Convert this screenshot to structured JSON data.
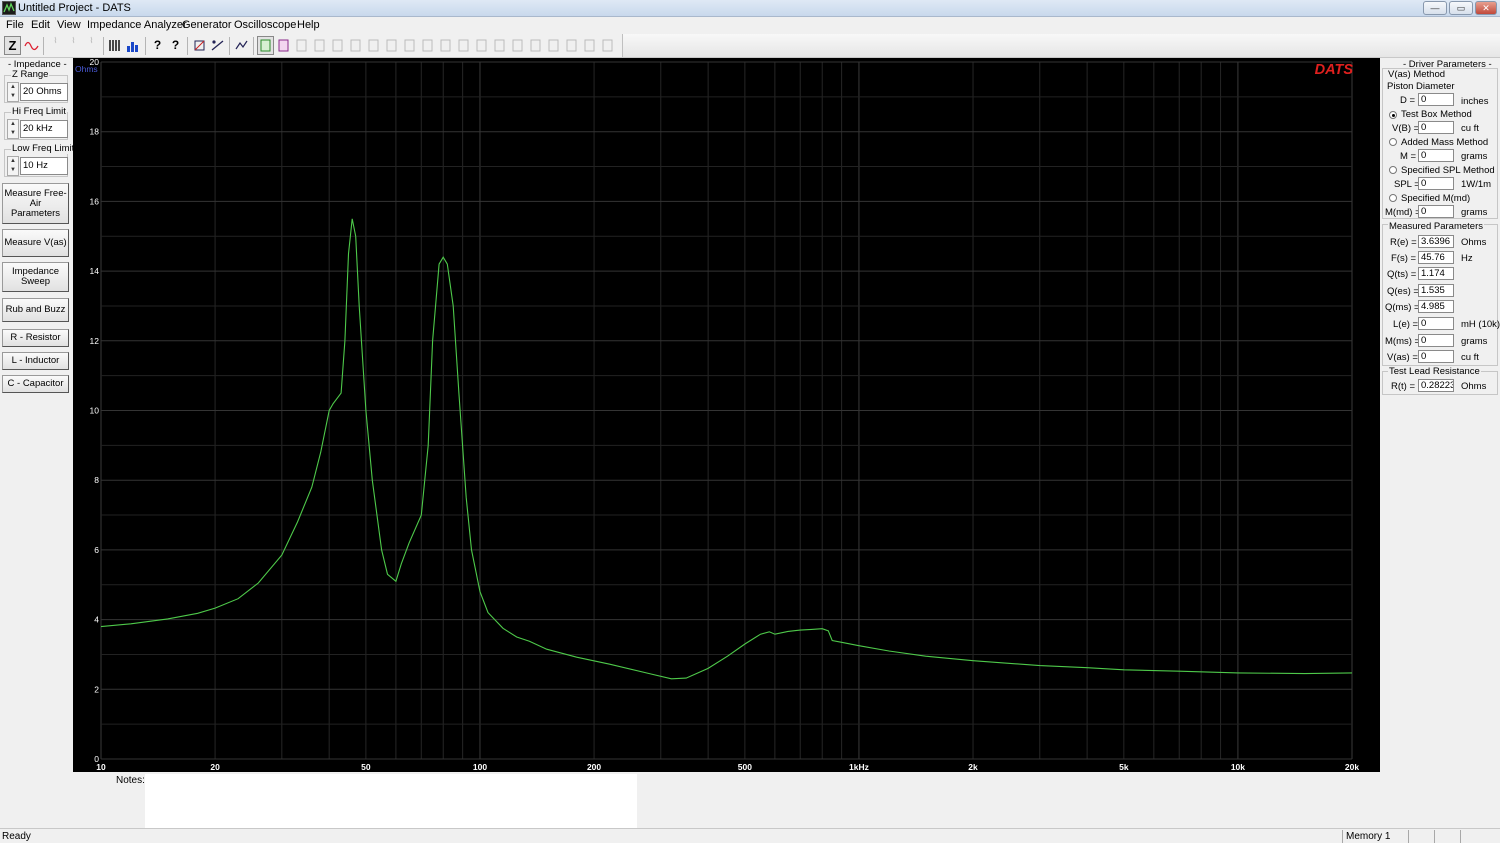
{
  "window": {
    "title": "Untitled Project - DATS",
    "controls": {
      "minimize": "—",
      "maximize": "▭",
      "close": "✕"
    }
  },
  "menu": [
    "File",
    "Edit",
    "View",
    "Impedance Analyzer",
    "Generator",
    "Oscilloscope",
    "Help"
  ],
  "toolbar": {
    "buttons": [
      {
        "name": "impedance-mode-button",
        "label": "Z",
        "icon": "z-icon"
      },
      {
        "name": "phase-mode-button",
        "label": "",
        "icon": "sine-wave-icon"
      },
      {
        "name": "tb-dim-1-button",
        "label": "⌇",
        "icon": "dim-icon"
      },
      {
        "name": "tb-dim-2-button",
        "label": "⌇",
        "icon": "dim-icon"
      },
      {
        "name": "tb-dim-3-button",
        "label": "⌇",
        "icon": "dim-icon"
      },
      {
        "name": "generator-button",
        "label": "",
        "icon": "bars-icon"
      },
      {
        "name": "analyzer-button",
        "label": "",
        "icon": "histogram-icon"
      },
      {
        "name": "help-button",
        "label": "?",
        "icon": "question-icon"
      },
      {
        "name": "context-help-button",
        "label": "?",
        "icon": "context-help-icon"
      },
      {
        "name": "tb-a-button",
        "label": "",
        "icon": "tool-icon"
      },
      {
        "name": "tb-b-button",
        "label": "",
        "icon": "tool-icon"
      },
      {
        "name": "tb-c-button",
        "label": "",
        "icon": "tool-icon"
      },
      {
        "name": "memory-1-button",
        "label": "",
        "icon": "memory-icon"
      },
      {
        "name": "memory-2-button",
        "label": "",
        "icon": "memory-icon"
      }
    ]
  },
  "left_panel": {
    "group_title": "- Impedance -",
    "z_range": {
      "label": "Z Range",
      "value": "20 Ohms"
    },
    "hi_freq": {
      "label": "Hi Freq Limit",
      "value": "20 kHz"
    },
    "low_freq": {
      "label": "Low Freq Limit",
      "value": "10 Hz"
    },
    "buttons": {
      "free_air": "Measure Free-Air Parameters",
      "measure_vas": "Measure V(as)",
      "impedance_sweep": "Impedance Sweep",
      "rub_buzz": "Rub and Buzz",
      "resistor": "R - Resistor",
      "inductor": "L - Inductor",
      "capacitor": "C - Capacitor"
    }
  },
  "chart_data": {
    "type": "line",
    "brand": "DATS",
    "y_unit": "Ohms",
    "xscale": "log",
    "xlim": [
      10,
      20000
    ],
    "ylim": [
      0,
      20
    ],
    "grid": true,
    "x_ticks": [
      {
        "value": 10,
        "label": "10"
      },
      {
        "value": 20,
        "label": "20"
      },
      {
        "value": 50,
        "label": "50"
      },
      {
        "value": 100,
        "label": "100"
      },
      {
        "value": 200,
        "label": "200"
      },
      {
        "value": 500,
        "label": "500"
      },
      {
        "value": 1000,
        "label": "1kHz"
      },
      {
        "value": 2000,
        "label": "2k"
      },
      {
        "value": 5000,
        "label": "5k"
      },
      {
        "value": 10000,
        "label": "10k"
      },
      {
        "value": 20000,
        "label": "20k"
      }
    ],
    "y_ticks": [
      0,
      2,
      4,
      6,
      8,
      10,
      12,
      14,
      16,
      18,
      20
    ],
    "colors": {
      "background": "#000000",
      "grid": "#2d2d2d",
      "curve": "#4ec94a",
      "axis_text": "#ffffff",
      "brand": "#e0201e",
      "unit": "#4a5ad8"
    },
    "series": [
      {
        "x": [
          10,
          12,
          15,
          18,
          20,
          23,
          26,
          30,
          33,
          36,
          38,
          40,
          41,
          43,
          44,
          45,
          46,
          47,
          48,
          50,
          52,
          55,
          57,
          60,
          62,
          65,
          70,
          73,
          75,
          78,
          80,
          82,
          85,
          88,
          92,
          95,
          100,
          105,
          115,
          125,
          135,
          150,
          180,
          220,
          280,
          320,
          350,
          400,
          450,
          500,
          550,
          580,
          600,
          650,
          700,
          750,
          800,
          830,
          850,
          900,
          1000,
          1200,
          1500,
          2000,
          3000,
          4000,
          5000,
          7000,
          10000,
          15000,
          20000
        ],
        "y": [
          3.8,
          3.88,
          4.02,
          4.18,
          4.33,
          4.6,
          5.05,
          5.85,
          6.8,
          7.8,
          8.8,
          10.0,
          10.2,
          10.5,
          12.0,
          14.5,
          15.5,
          15.0,
          13.0,
          10.0,
          8.0,
          6.0,
          5.3,
          5.1,
          5.6,
          6.2,
          7.0,
          9.0,
          12.0,
          14.2,
          14.4,
          14.2,
          13.0,
          10.5,
          7.5,
          6.0,
          4.8,
          4.2,
          3.75,
          3.5,
          3.38,
          3.15,
          2.92,
          2.72,
          2.45,
          2.3,
          2.32,
          2.6,
          2.95,
          3.3,
          3.58,
          3.65,
          3.58,
          3.66,
          3.7,
          3.72,
          3.74,
          3.68,
          3.4,
          3.35,
          3.25,
          3.1,
          2.95,
          2.82,
          2.68,
          2.62,
          2.56,
          2.52,
          2.47,
          2.45,
          2.47
        ]
      }
    ]
  },
  "right_panel": {
    "title": "- Driver Parameters -",
    "vas_method": "V(as) Method",
    "piston_diameter": "Piston Diameter",
    "d": {
      "label": "D =",
      "value": "0",
      "unit": "inches"
    },
    "test_box": {
      "label": "Test Box Method",
      "selected": true
    },
    "vb": {
      "label": "V(B) =",
      "value": "0",
      "unit": "cu ft"
    },
    "added_mass": {
      "label": "Added Mass Method",
      "selected": false
    },
    "m": {
      "label": "M =",
      "value": "0",
      "unit": "grams"
    },
    "spl_method": {
      "label": "Specified SPL Method",
      "selected": false
    },
    "spl": {
      "label": "SPL =",
      "value": "0",
      "unit": "1W/1m"
    },
    "mmd_method": {
      "label": "Specified M(md)",
      "selected": false
    },
    "mmd": {
      "label": "M(md) =",
      "value": "0",
      "unit": "grams"
    },
    "measured_title": "Measured Parameters",
    "measured": [
      {
        "label": "R(e) =",
        "value": "3.6396",
        "unit": "Ohms"
      },
      {
        "label": "F(s) =",
        "value": "45.76",
        "unit": "Hz"
      },
      {
        "label": "Q(ts) =",
        "value": "1.174",
        "unit": ""
      },
      {
        "label": "Q(es) =",
        "value": "1.535",
        "unit": ""
      },
      {
        "label": "Q(ms) =",
        "value": "4.985",
        "unit": ""
      },
      {
        "label": "L(e) =",
        "value": "0",
        "unit": "mH (10k)"
      },
      {
        "label": "M(ms) =",
        "value": "0",
        "unit": "grams"
      },
      {
        "label": "V(as) =",
        "value": "0",
        "unit": "cu ft"
      }
    ],
    "lead_title": "Test Lead Resistance",
    "lead": {
      "label": "R(t) =",
      "value": "0.28223",
      "unit": "Ohms"
    }
  },
  "notes": {
    "label": "Notes:",
    "value": ""
  },
  "status": {
    "text": "Ready",
    "memory": "Memory 1"
  }
}
